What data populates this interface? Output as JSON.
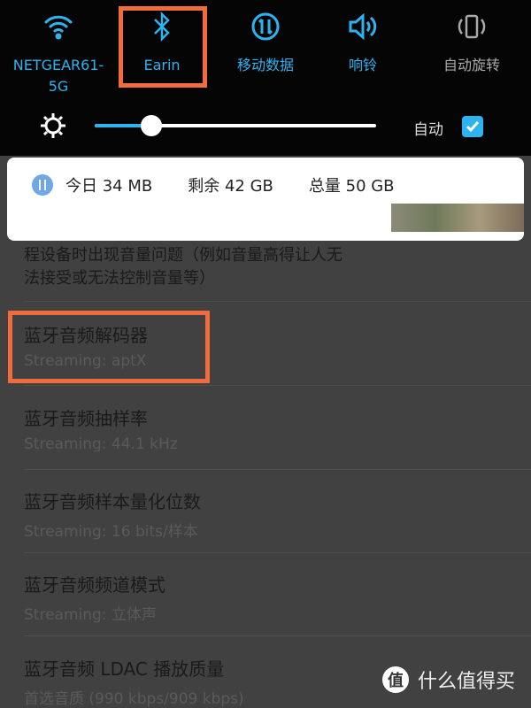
{
  "quick_settings": {
    "tiles": [
      {
        "label": "NETGEAR61-\n5G",
        "line1": "NETGEAR61-",
        "line2": "5G",
        "icon": "wifi-icon",
        "active": true
      },
      {
        "label": "Earin",
        "icon": "bluetooth-icon",
        "active": true
      },
      {
        "label": "移动数据",
        "icon": "mobile-data-icon",
        "active": true
      },
      {
        "label": "响铃",
        "icon": "speaker-icon",
        "active": true
      },
      {
        "label": "自动旋转",
        "icon": "auto-rotate-icon",
        "active": false
      }
    ],
    "brightness_percent": 20,
    "auto_label": "自动",
    "auto_checked": true
  },
  "data_usage": {
    "today": "今日 34 MB",
    "remaining": "剩余 42 GB",
    "total": "总量 50 GB"
  },
  "settings": {
    "partial_text_1": "程设备时出现音量问题（例如音量高得让人无",
    "partial_text_2": "法接受或无法控制音量等）",
    "items": [
      {
        "title": "蓝牙音频解码器",
        "subtitle": "Streaming: aptX"
      },
      {
        "title": "蓝牙音频抽样率",
        "subtitle": "Streaming: 44.1 kHz"
      },
      {
        "title": "蓝牙音频样本量化位数",
        "subtitle": "Streaming: 16 bits/样本"
      },
      {
        "title": "蓝牙音频频道模式",
        "subtitle": "Streaming: 立体声"
      },
      {
        "title": "蓝牙音频 LDAC 播放质量",
        "subtitle": "首选音质 (990 kbps/909 kbps)"
      }
    ]
  },
  "watermark": {
    "logo": "值",
    "text": "什么值得买"
  },
  "colors": {
    "accent": "#2db4f0",
    "highlight": "#f26b3a"
  }
}
